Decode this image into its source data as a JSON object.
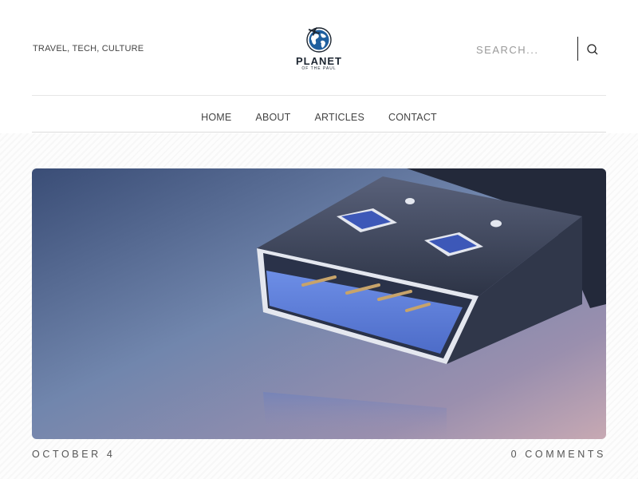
{
  "header": {
    "tagline": "TRAVEL, TECH, CULTURE",
    "logo": {
      "name": "PLANET",
      "subtitle": "OF THE PAUL",
      "icon": "globe-airplane-icon"
    },
    "search": {
      "placeholder": "SEARCH...",
      "icon": "search-icon"
    }
  },
  "nav": {
    "items": [
      {
        "label": "HOME"
      },
      {
        "label": "ABOUT"
      },
      {
        "label": "ARTICLES"
      },
      {
        "label": "CONTACT"
      }
    ]
  },
  "post": {
    "image": "usb-connector-closeup",
    "date": "OCTOBER 4",
    "comments": "0 COMMENTS"
  },
  "colors": {
    "logo_globe": "#1f5f9e",
    "logo_text": "#1c2530",
    "usb_blue": "#5b7fd6"
  }
}
